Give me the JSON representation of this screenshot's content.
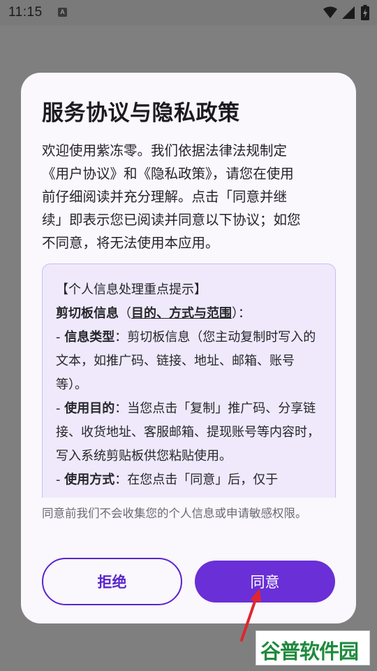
{
  "status_bar": {
    "time": "11:15",
    "notification_icon_letter": "A",
    "icons": [
      "wifi-icon",
      "signal-icon",
      "battery-charging-icon"
    ]
  },
  "dialog": {
    "title": "服务协议与隐私政策",
    "intro_lines": [
      "欢迎使用紫冻零。我们依据法律法规制定",
      "《用户协议》和《隐私政策》，请您在使用",
      "前仔细阅读并充分理解。点击「同意并继",
      "续」即表示您已阅读并同意以下协议；如您",
      "不同意，将无法使用本应用。"
    ],
    "info_box": {
      "heading": "【个人信息处理重点提示】",
      "section_label": "剪切板信息",
      "section_paren_open": "（",
      "section_purpose": "目的、方式与范围",
      "section_paren_close": "）：",
      "item1_prefix": "- ",
      "item1_label": "信息类型",
      "item1_colon": "：",
      "item1_text": "剪切板信息（您主动复制时写入的文本，如推广码、链接、地址、邮箱、账号等）。",
      "item2_prefix": "- ",
      "item2_label": "使用目的",
      "item2_colon": "：",
      "item2_text": "当您点击「复制」推广码、分享链接、收货地址、客服邮箱、提现账号等内容时，写入系统剪贴板供您粘贴使用。",
      "item3_prefix": "- ",
      "item3_label": "使用方式",
      "item3_colon": "：",
      "item3_text": "在您点击「同意」后，仅于"
    },
    "footer_note": "同意前我们不会收集您的个人信息或申请敏感权限。",
    "reject_label": "拒绝",
    "agree_label": "同意"
  },
  "watermark": {
    "text": "谷普软件园"
  },
  "colors": {
    "accent": "#6a2fd6",
    "accent_outline": "#5b25cc",
    "dialog_bg": "#faf7fd",
    "info_bg": "#efe9fb",
    "arrow": "#e0262d",
    "watermark_green": "#1f8a3d"
  }
}
